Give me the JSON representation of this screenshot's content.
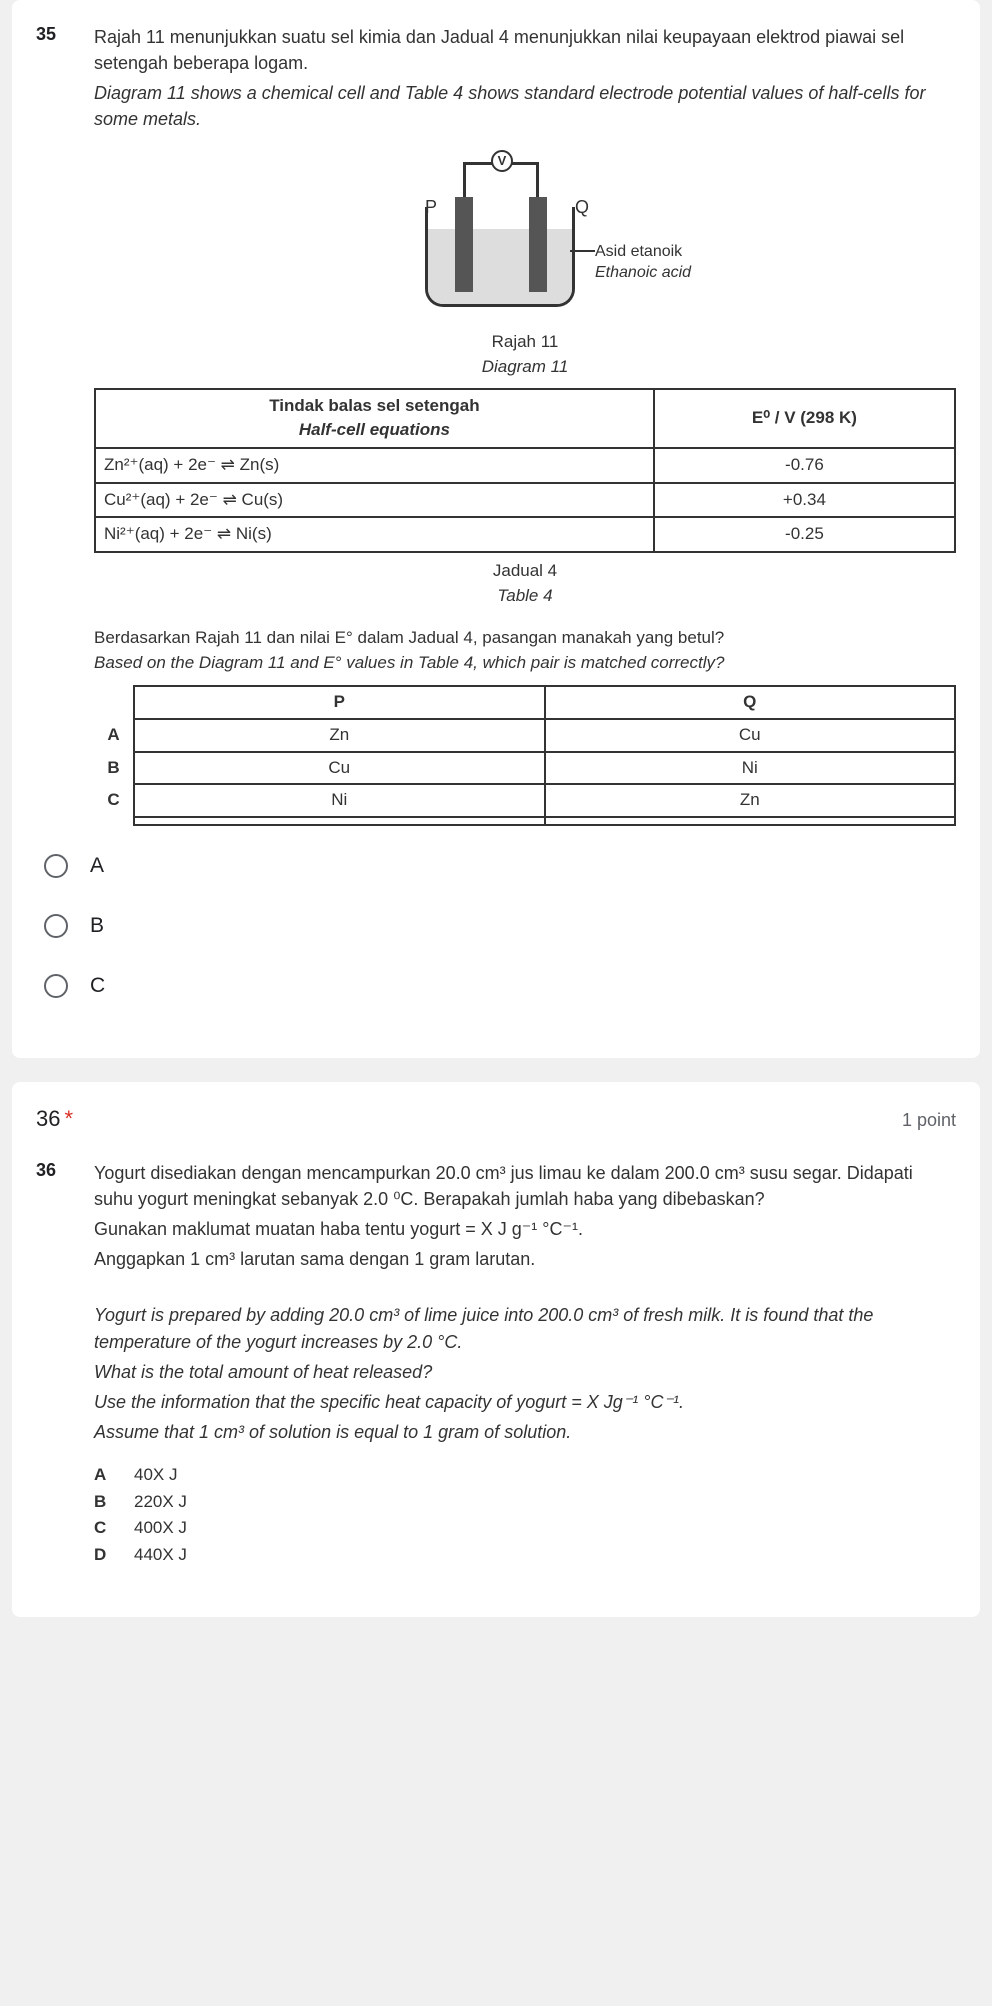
{
  "q35": {
    "number": "35",
    "text_ms_1": "Rajah 11 menunjukkan suatu sel kimia dan Jadual 4 menunjukkan nilai keupayaan elektrod piawai sel setengah beberapa logam.",
    "text_en_1": "Diagram 11 shows a chemical cell and Table 4 shows standard electrode potential values of half-cells for some metals.",
    "diagram": {
      "volt": "V",
      "P": "P",
      "Q": "Q",
      "acid_ms": "Asid etanoik",
      "acid_en": "Ethanoic acid",
      "caption_ms": "Rajah 11",
      "caption_en": "Diagram 11"
    },
    "table4": {
      "header_left_ms": "Tindak balas sel setengah",
      "header_left_en": "Half-cell equations",
      "header_right": "E⁰ / V (298 K)",
      "rows": [
        {
          "eq": "Zn²⁺(aq) + 2e⁻ ⇌ Zn(s)",
          "val": "-0.76"
        },
        {
          "eq": "Cu²⁺(aq) + 2e⁻ ⇌ Cu(s)",
          "val": "+0.34"
        },
        {
          "eq": "Ni²⁺(aq) + 2e⁻ ⇌ Ni(s)",
          "val": "-0.25"
        }
      ],
      "caption_ms": "Jadual 4",
      "caption_en": "Table 4"
    },
    "question_ms": "Berdasarkan Rajah 11 dan nilai E° dalam Jadual 4, pasangan manakah yang betul?",
    "question_en": "Based on the Diagram 11 and E° values in Table 4, which pair is matched correctly?",
    "answer_table": {
      "headP": "P",
      "headQ": "Q",
      "rows": [
        {
          "label": "A",
          "p": "Zn",
          "q": "Cu"
        },
        {
          "label": "B",
          "p": "Cu",
          "q": "Ni"
        },
        {
          "label": "C",
          "p": "Ni",
          "q": "Zn"
        }
      ]
    },
    "options": [
      "A",
      "B",
      "C"
    ]
  },
  "q36": {
    "header_num": "36",
    "header_star": "*",
    "points": "1 point",
    "number": "36",
    "text_ms_1": "Yogurt disediakan dengan mencampurkan 20.0 cm³ jus limau ke dalam 200.0 cm³ susu segar. Didapati suhu yogurt meningkat sebanyak 2.0 ⁰C. Berapakah jumlah haba yang dibebaskan?",
    "text_ms_2": "Gunakan maklumat muatan haba tentu yogurt = X J g⁻¹ °C⁻¹.",
    "text_ms_3": "Anggapkan 1 cm³ larutan sama dengan 1 gram larutan.",
    "text_en_1": "Yogurt is prepared by adding 20.0 cm³ of lime juice into 200.0 cm³ of fresh milk. It is found that the temperature of the yogurt increases by 2.0 °C.",
    "text_en_2": "What is the total amount of heat released?",
    "text_en_3": "Use the information that the specific heat capacity of yogurt = X Jg⁻¹ °C⁻¹.",
    "text_en_4": "Assume that 1 cm³ of solution is equal to 1 gram of solution.",
    "answers": [
      {
        "k": "A",
        "v": "40X J"
      },
      {
        "k": "B",
        "v": "220X J"
      },
      {
        "k": "C",
        "v": "400X J"
      },
      {
        "k": "D",
        "v": "440X J"
      }
    ]
  }
}
